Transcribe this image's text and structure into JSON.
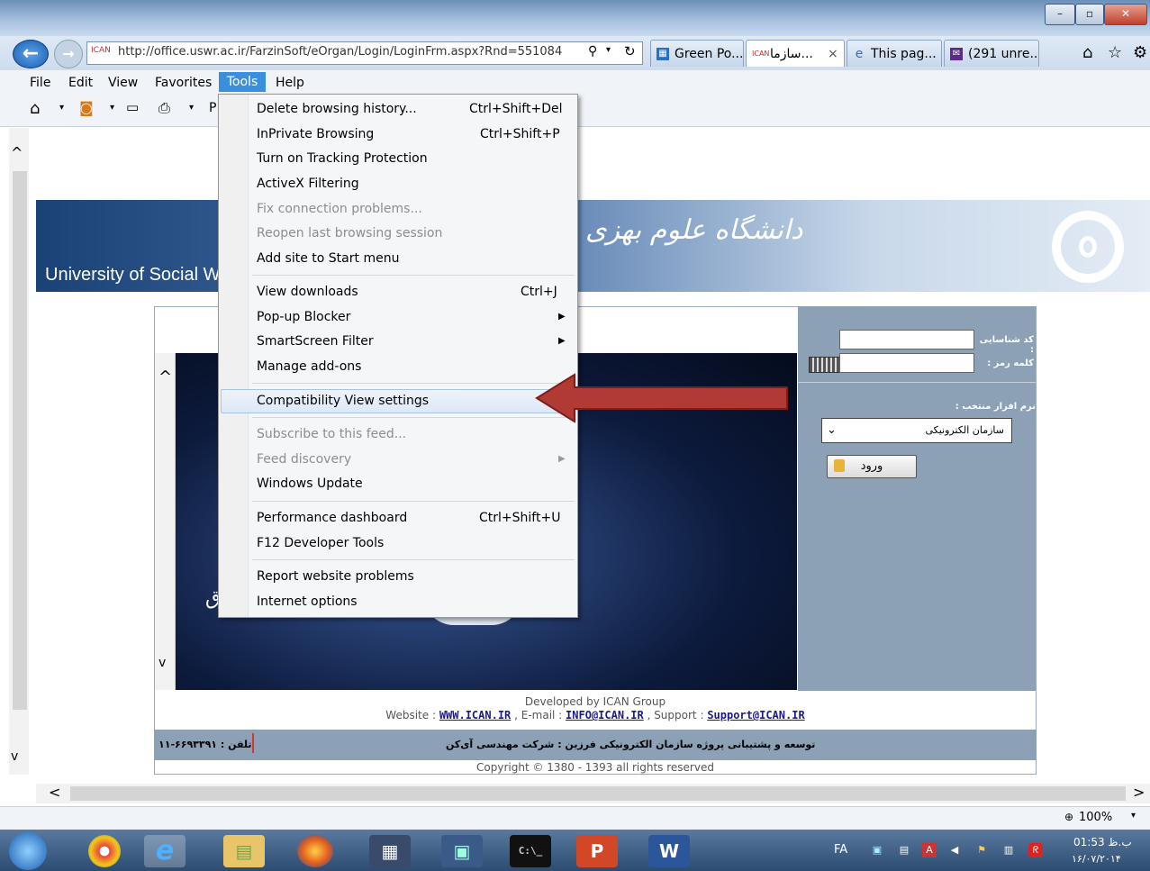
{
  "browser": {
    "url": "http://office.uswr.ac.ir/FarzinSoft/eOrgan/Login/LoginFrm.aspx?Rnd=551084",
    "tabs": [
      {
        "label": "Green Po...",
        "active": false
      },
      {
        "label": "سازما...",
        "active": true
      },
      {
        "label": "This pag...",
        "active": false
      },
      {
        "label": "(291 unre...",
        "active": false
      }
    ],
    "tab_close": "×",
    "menubar": [
      "File",
      "Edit",
      "View",
      "Favorites",
      "Tools",
      "Help"
    ],
    "cmd_letter": "P",
    "zoom": "100%"
  },
  "tools_menu": {
    "items": [
      {
        "label": "Delete browsing history...",
        "shortcut": "Ctrl+Shift+Del",
        "disabled": false
      },
      {
        "label": "InPrivate Browsing",
        "shortcut": "Ctrl+Shift+P",
        "disabled": false
      },
      {
        "label": "Turn on Tracking Protection",
        "shortcut": "",
        "disabled": false
      },
      {
        "label": "ActiveX Filtering",
        "shortcut": "",
        "disabled": false
      },
      {
        "label": "Fix connection problems...",
        "shortcut": "",
        "disabled": true
      },
      {
        "label": "Reopen last browsing session",
        "shortcut": "",
        "disabled": true
      },
      {
        "label": "Add site to Start menu",
        "shortcut": "",
        "disabled": false
      },
      {
        "label": "View downloads",
        "shortcut": "Ctrl+J",
        "disabled": false
      },
      {
        "label": "Pop-up Blocker",
        "shortcut": "",
        "disabled": false
      },
      {
        "label": "SmartScreen Filter",
        "shortcut": "",
        "disabled": false
      },
      {
        "label": "Manage add-ons",
        "shortcut": "",
        "disabled": false
      },
      {
        "label": "Compatibility View settings",
        "shortcut": "",
        "disabled": false
      },
      {
        "label": "Subscribe to this feed...",
        "shortcut": "",
        "disabled": true
      },
      {
        "label": "Feed discovery",
        "shortcut": "",
        "disabled": true
      },
      {
        "label": "Windows Update",
        "shortcut": "",
        "disabled": false
      },
      {
        "label": "Performance dashboard",
        "shortcut": "Ctrl+Shift+U",
        "disabled": false
      },
      {
        "label": "F12 Developer Tools",
        "shortcut": "",
        "disabled": false
      },
      {
        "label": "Report website problems",
        "shortcut": "",
        "disabled": false
      },
      {
        "label": "Internet options",
        "shortcut": "",
        "disabled": false
      }
    ]
  },
  "page": {
    "banner_en": "University of Social We",
    "banner_fa": "دانشگاه علوم بهزی",
    "login": {
      "username_label": "كد شناسایی :",
      "password_label": "كلمه رمز :",
      "software_label": "نرم افزار منتخب :",
      "software_selected": "سازمان الكترونیكی",
      "submit_label": "ورود"
    },
    "image_glyph": "ق",
    "footer": {
      "developed_by": "Developed by ICAN Group",
      "website_prefix": "Website : ",
      "website": "WWW.ICAN.IR",
      "email_prefix": " , E-mail : ",
      "email": "INFO@ICAN.IR",
      "support_prefix": " , Support : ",
      "support": "Support@ICAN.IR",
      "fa_dev": "توسعه و پشتیبانی پروژه سازمان الكترونیكی فرزین : شركت مهندسی آی‌كن",
      "fa_phone": "تلفن : ۶۶۹۳۳۹۱-۱۱",
      "copyright": "Copyright © 1380 - 1393 all rights reserved"
    }
  },
  "taskbar": {
    "lang": "FA",
    "time": "01:53 ب.ظ",
    "date": "۱۶/۰۷/۲۰۱۴"
  },
  "colors": {
    "menu_highlight": "#3b8edb",
    "arrow_red": "#b23a34",
    "panel_blue": "#8ca0b6"
  }
}
